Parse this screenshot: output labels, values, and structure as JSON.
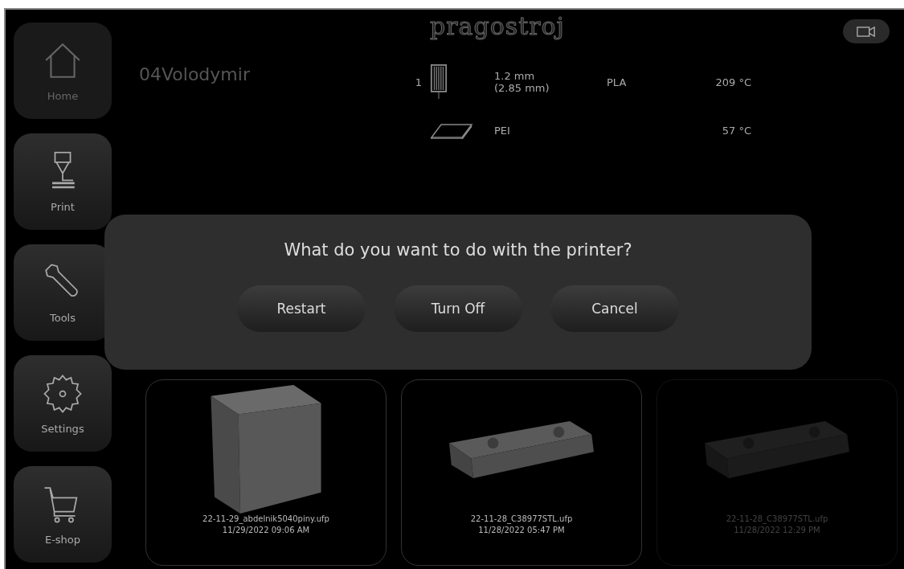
{
  "logo": "pragostroj",
  "sidebar": {
    "items": [
      {
        "label": "Home",
        "selected": true
      },
      {
        "label": "Print",
        "selected": false
      },
      {
        "label": "Tools",
        "selected": false
      },
      {
        "label": "Settings",
        "selected": false
      },
      {
        "label": "E-shop",
        "selected": false
      }
    ]
  },
  "printer_name": "04Volodymir",
  "extruder": {
    "index": "1",
    "nozzle": "1.2 mm",
    "filament_diameter": "(2.85 mm)",
    "material": "PLA",
    "temperature": "209 °C"
  },
  "bed": {
    "surface": "PEI",
    "temperature": "57 °C"
  },
  "files": [
    {
      "name": "22-11-29_abdelnik5040piny.ufp",
      "date": "11/29/2022 09:06 AM",
      "disabled": false
    },
    {
      "name": "22-11-28_C38977STL.ufp",
      "date": "11/28/2022 05:47 PM",
      "disabled": false
    },
    {
      "name": "22-11-28_C38977STL.ufp",
      "date": "11/28/2022 12:29 PM",
      "disabled": true
    }
  ],
  "dialog": {
    "message": "What do you want to do with the printer?",
    "buttons": [
      "Restart",
      "Turn Off",
      "Cancel"
    ]
  }
}
